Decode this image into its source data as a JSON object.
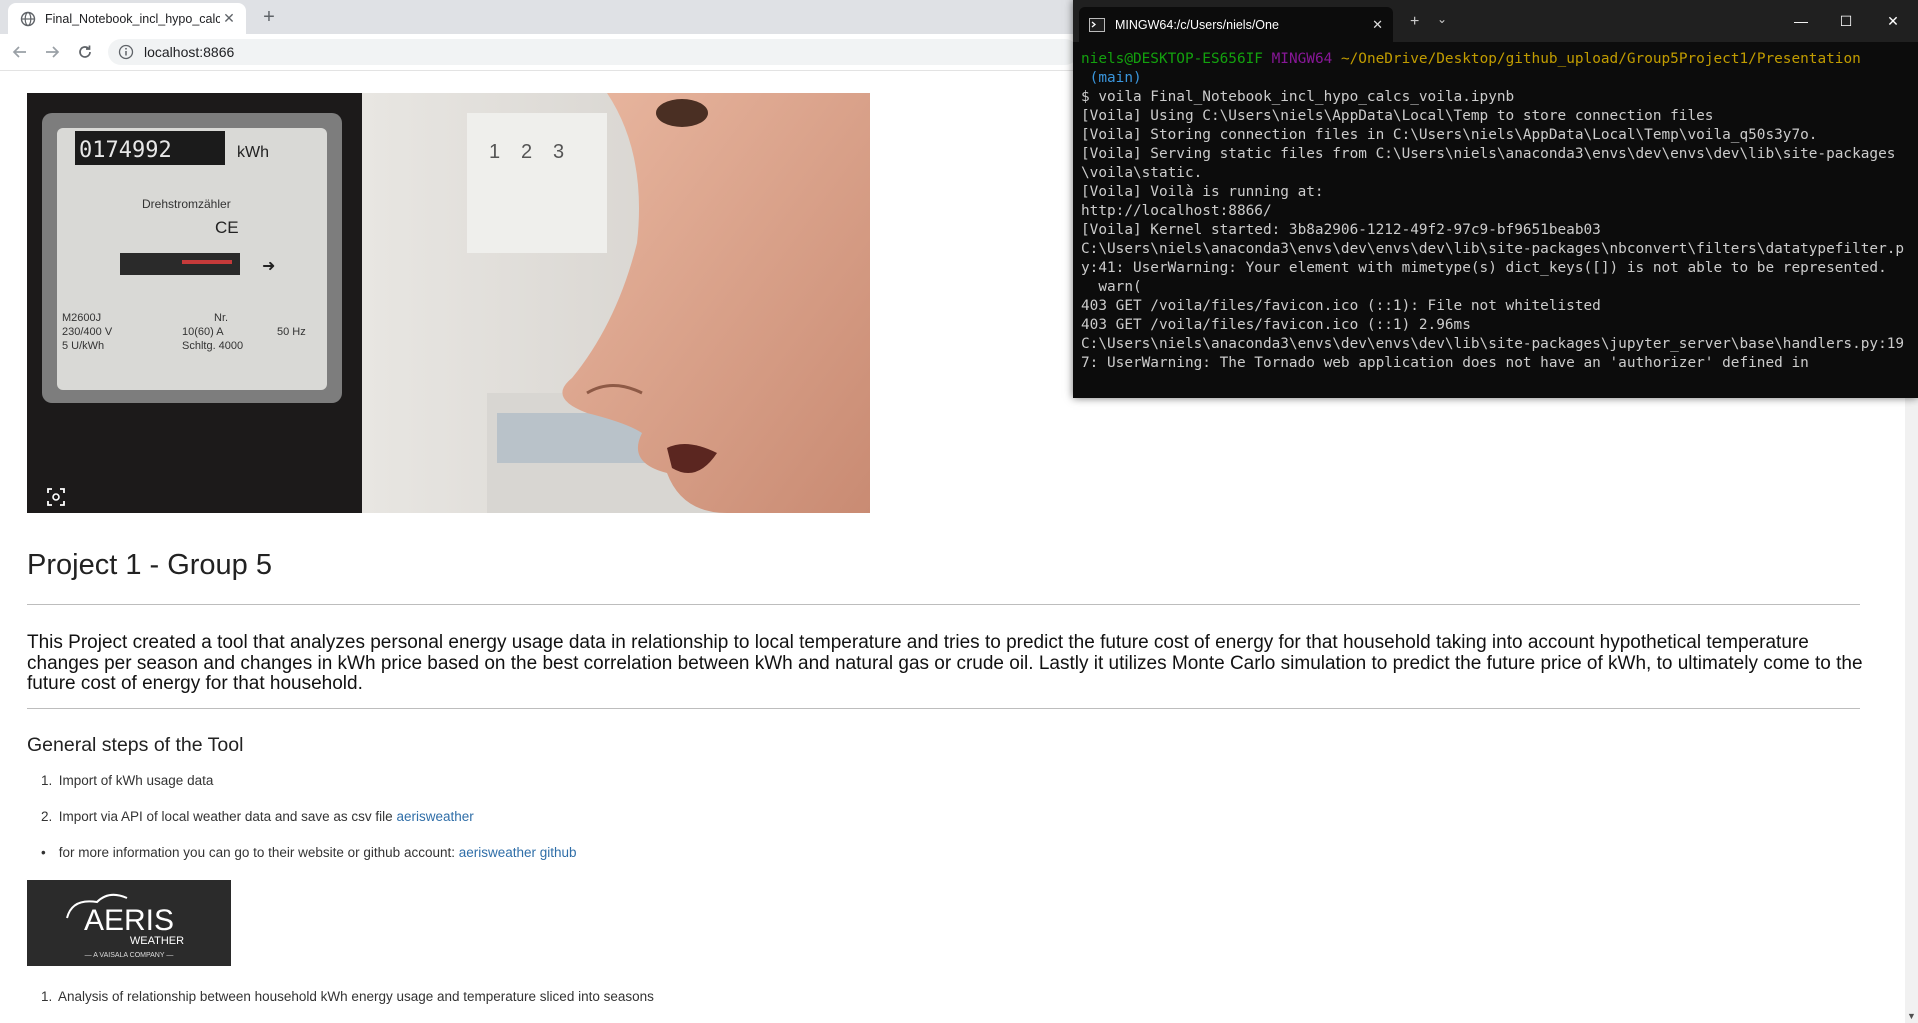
{
  "browser": {
    "tab_title": "Final_Notebook_incl_hypo_calcs_",
    "new_tab_label": "+",
    "url": "localhost:8866"
  },
  "page": {
    "title": "Project 1 - Group 5",
    "intro": "This Project created a tool that analyzes personal energy usage data in relationship to local temperature and tries to predict the future cost of energy for that household taking into account hypothetical temperature changes per season and changes in kWh price based on the best correlation between kWh and natural gas or crude oil. Lastly it utilizes Monte Carlo simulation to predict the future price of kWh, to ultimately come to the future cost of energy for that household.",
    "steps_heading": "General steps of the Tool",
    "steps": [
      {
        "num": "1.",
        "text": "Import of kWh usage data"
      },
      {
        "num": "2.",
        "text": "Import via API of local weather data and save as csv file ",
        "link": "aerisweather"
      },
      {
        "num": "•",
        "text": "for more information you can go to their website or github account: ",
        "link": "aerisweather github"
      },
      {
        "num": "1.",
        "text": "Analysis of relationship between household kWh energy usage and temperature sliced into seasons"
      }
    ],
    "hero_meter": {
      "counter": "0174992",
      "unit": "kWh",
      "label": "Drehstromzähler",
      "model": "M2600J",
      "volt": "230/400 V",
      "amp": "10(60) A",
      "hz": "50 Hz",
      "nr": "Nr.",
      "rev": "5 U/kWh",
      "schlt": "Schltg. 4000",
      "ce": "CE",
      "fuse_labels": [
        "1",
        "2",
        "3"
      ]
    },
    "aeris_logo": {
      "line1": "AERIS",
      "line2": "WEATHER",
      "line3": "— A VAISALA COMPANY —"
    }
  },
  "terminal": {
    "tab_title": "MINGW64:/c/Users/niels/One",
    "prompt_user": "niels@DESKTOP-ES656IF",
    "prompt_host": "MINGW64",
    "prompt_path": "~/OneDrive/Desktop/github_upload/Group5Project1/Presentation",
    "prompt_branch": " (main)",
    "command": "$ voila Final_Notebook_incl_hypo_calcs_voila.ipynb",
    "output": "[Voila] Using C:\\Users\\niels\\AppData\\Local\\Temp to store connection files\n[Voila] Storing connection files in C:\\Users\\niels\\AppData\\Local\\Temp\\voila_q50s3y7o.\n[Voila] Serving static files from C:\\Users\\niels\\anaconda3\\envs\\dev\\envs\\dev\\lib\\site-packages\\voila\\static.\n[Voila] Voilà is running at:\nhttp://localhost:8866/\n[Voila] Kernel started: 3b8a2906-1212-49f2-97c9-bf9651beab03\nC:\\Users\\niels\\anaconda3\\envs\\dev\\envs\\dev\\lib\\site-packages\\nbconvert\\filters\\datatypefilter.py:41: UserWarning: Your element with mimetype(s) dict_keys([]) is not able to be represented.\n  warn(\n403 GET /voila/files/favicon.ico (::1): File not whitelisted\n403 GET /voila/files/favicon.ico (::1) 2.96ms\nC:\\Users\\niels\\anaconda3\\envs\\dev\\envs\\dev\\lib\\site-packages\\jupyter_server\\base\\handlers.py:197: UserWarning: The Tornado web application does not have an 'authorizer' defined in"
  }
}
